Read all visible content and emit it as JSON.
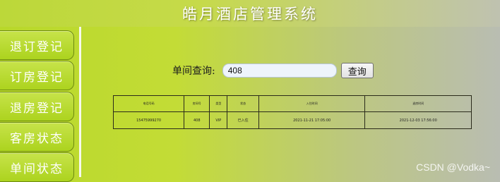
{
  "header": {
    "title": "皓月酒店管理系统"
  },
  "sidebar": {
    "items": [
      {
        "label": "退订登记"
      },
      {
        "label": "订房登记"
      },
      {
        "label": "退房登记"
      },
      {
        "label": "客房状态"
      },
      {
        "label": "单间状态"
      }
    ]
  },
  "search": {
    "label": "单间查询:",
    "value": "408",
    "button_label": "查询"
  },
  "table": {
    "headers": [
      "电话号码",
      "房间号",
      "类型",
      "状态",
      "入住时间",
      "退房时间"
    ],
    "rows": [
      [
        "15475999270",
        "408",
        "VIP",
        "已入住",
        "2021-11-21 17:05:00",
        "2021-12-03 17:56:00"
      ]
    ]
  },
  "watermark": "CSDN @Vodka~"
}
